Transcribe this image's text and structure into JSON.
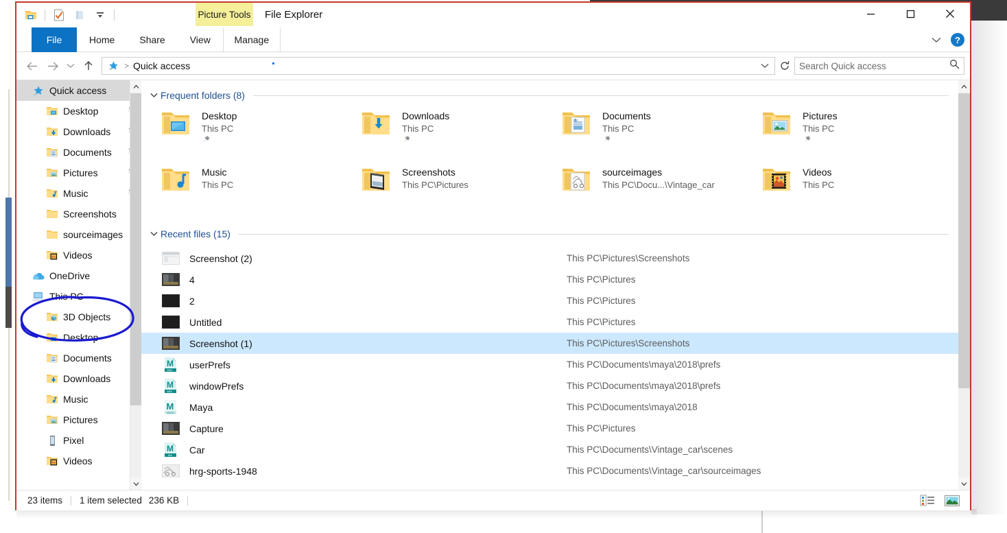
{
  "window": {
    "app_title": "File Explorer",
    "contextual_tab_title": "Picture Tools",
    "contextual_tab_color": "#f5ef9a",
    "accent_color": "#0b72c4",
    "border_color": "#c0392b",
    "minimize_label": "Minimize",
    "maximize_label": "Maximize",
    "close_label": "Close"
  },
  "quick_access_toolbar": {
    "items": [
      {
        "name": "save-icon",
        "label": "Save"
      },
      {
        "name": "properties-icon",
        "label": "Properties"
      },
      {
        "name": "new-folder-icon",
        "label": "New folder"
      },
      {
        "name": "customize-dropdown-icon",
        "label": "Customize Quick Access Toolbar"
      }
    ]
  },
  "ribbon": {
    "tabs": [
      {
        "label": "File",
        "active": false,
        "kind": "file"
      },
      {
        "label": "Home",
        "active": false,
        "kind": "normal"
      },
      {
        "label": "Share",
        "active": false,
        "kind": "normal"
      },
      {
        "label": "View",
        "active": false,
        "kind": "normal"
      },
      {
        "label": "Manage",
        "active": false,
        "kind": "manage"
      }
    ],
    "collapse_label": "Minimize the Ribbon",
    "help_label": "?"
  },
  "address_bar": {
    "breadcrumb_icon": "quick-access-star-icon",
    "separator": ">",
    "crumb": "Quick access",
    "dropdown_label": "Previous locations",
    "refresh_label": "Refresh"
  },
  "search": {
    "placeholder": "Search Quick access",
    "value": "",
    "icon": "search-icon"
  },
  "navigation": {
    "back_label": "Back",
    "forward_label": "Forward",
    "recent_label": "Recent locations",
    "up_label": "Up",
    "items": [
      {
        "label": "Quick access",
        "icon": "quick-access-star-icon",
        "level": 0,
        "selected": true,
        "pinned": false
      },
      {
        "label": "Desktop",
        "icon": "folder-desktop-icon",
        "level": 1,
        "selected": false,
        "pinned": true
      },
      {
        "label": "Downloads",
        "icon": "folder-downloads-icon",
        "level": 1,
        "selected": false,
        "pinned": true
      },
      {
        "label": "Documents",
        "icon": "folder-documents-icon",
        "level": 1,
        "selected": false,
        "pinned": true
      },
      {
        "label": "Pictures",
        "icon": "folder-pictures-icon",
        "level": 1,
        "selected": false,
        "pinned": true
      },
      {
        "label": "Music",
        "icon": "folder-music-icon",
        "level": 1,
        "selected": false,
        "pinned": true
      },
      {
        "label": "Screenshots",
        "icon": "folder-icon",
        "level": 1,
        "selected": false,
        "pinned": false
      },
      {
        "label": "sourceimages",
        "icon": "folder-icon",
        "level": 1,
        "selected": false,
        "pinned": false
      },
      {
        "label": "Videos",
        "icon": "folder-videos-icon",
        "level": 1,
        "selected": false,
        "pinned": false
      },
      {
        "label": "OneDrive",
        "icon": "onedrive-cloud-icon",
        "level": 0,
        "selected": false,
        "pinned": false
      },
      {
        "label": "This PC",
        "icon": "this-pc-icon",
        "level": 0,
        "selected": false,
        "pinned": false
      },
      {
        "label": "3D Objects",
        "icon": "folder-3dobjects-icon",
        "level": 1,
        "selected": false,
        "pinned": false
      },
      {
        "label": "Desktop",
        "icon": "folder-desktop-icon",
        "level": 1,
        "selected": false,
        "pinned": false
      },
      {
        "label": "Documents",
        "icon": "folder-documents-icon",
        "level": 1,
        "selected": false,
        "pinned": false
      },
      {
        "label": "Downloads",
        "icon": "folder-downloads-icon",
        "level": 1,
        "selected": false,
        "pinned": false
      },
      {
        "label": "Music",
        "icon": "folder-music-icon",
        "level": 1,
        "selected": false,
        "pinned": false
      },
      {
        "label": "Pictures",
        "icon": "folder-pictures-icon",
        "level": 1,
        "selected": false,
        "pinned": false
      },
      {
        "label": "Pixel",
        "icon": "phone-icon",
        "level": 1,
        "selected": false,
        "pinned": false
      },
      {
        "label": "Videos",
        "icon": "folder-videos-icon",
        "level": 1,
        "selected": false,
        "pinned": false
      }
    ]
  },
  "frequent_folders": {
    "header": "Frequent folders (8)",
    "expanded": true,
    "items": [
      {
        "name": "Desktop",
        "path": "This PC",
        "icon": "folder-desktop-icon",
        "pinned": true
      },
      {
        "name": "Downloads",
        "path": "This PC",
        "icon": "folder-downloads-icon",
        "pinned": true
      },
      {
        "name": "Documents",
        "path": "This PC",
        "icon": "folder-documents-icon",
        "pinned": true
      },
      {
        "name": "Pictures",
        "path": "This PC",
        "icon": "folder-pictures-icon",
        "pinned": true
      },
      {
        "name": "Music",
        "path": "This PC",
        "icon": "folder-music-icon",
        "pinned": false
      },
      {
        "name": "Screenshots",
        "path": "This PC\\Pictures",
        "icon": "folder-screenshots-icon",
        "pinned": false
      },
      {
        "name": "sourceimages",
        "path": "This PC\\Docu...\\Vintage_car",
        "icon": "folder-sourceimages-icon",
        "pinned": false
      },
      {
        "name": "Videos",
        "path": "This PC",
        "icon": "folder-videos-icon",
        "pinned": false
      }
    ]
  },
  "recent_files": {
    "header": "Recent files (15)",
    "expanded": true,
    "items": [
      {
        "name": "Screenshot (2)",
        "path": "This PC\\Pictures\\Screenshots",
        "icon": "image-thumb-light-icon",
        "selected": false
      },
      {
        "name": "4",
        "path": "This PC\\Pictures",
        "icon": "image-thumb-dark-icon",
        "selected": false
      },
      {
        "name": "2",
        "path": "This PC\\Pictures",
        "icon": "image-thumb-black-icon",
        "selected": false
      },
      {
        "name": "Untitled",
        "path": "This PC\\Pictures",
        "icon": "image-thumb-black-icon",
        "selected": false
      },
      {
        "name": "Screenshot (1)",
        "path": "This PC\\Pictures\\Screenshots",
        "icon": "image-thumb-dark-icon",
        "selected": true
      },
      {
        "name": "userPrefs",
        "path": "This PC\\Documents\\maya\\2018\\prefs",
        "icon": "maya-mel-icon",
        "selected": false
      },
      {
        "name": "windowPrefs",
        "path": "This PC\\Documents\\maya\\2018\\prefs",
        "icon": "maya-mel-icon",
        "selected": false
      },
      {
        "name": "Maya",
        "path": "This PC\\Documents\\maya\\2018",
        "icon": "maya-app-icon",
        "selected": false
      },
      {
        "name": "Capture",
        "path": "This PC\\Pictures",
        "icon": "image-thumb-dark-icon",
        "selected": false
      },
      {
        "name": "Car",
        "path": "This PC\\Documents\\Vintage_car\\scenes",
        "icon": "maya-ma-icon",
        "selected": false
      },
      {
        "name": "hrg-sports-1948",
        "path": "This PC\\Documents\\Vintage_car\\sourceimages",
        "icon": "image-thumb-sketch-icon",
        "selected": false
      }
    ]
  },
  "status_bar": {
    "item_count": "23 items",
    "selection": "1 item selected",
    "size": "236 KB",
    "view_details_label": "Details view",
    "view_large_icons_label": "Large icons view"
  },
  "annotation": {
    "shape": "hand-drawn-ellipse",
    "color": "#1a1ad0",
    "targets": "This PC"
  }
}
